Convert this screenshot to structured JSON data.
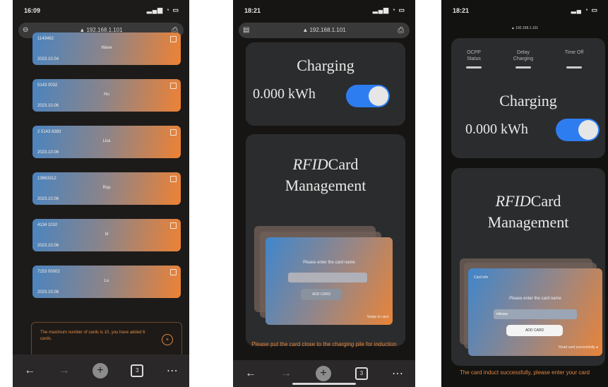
{
  "phone1": {
    "time": "16:09",
    "url": "192.168.1.101",
    "cards": [
      {
        "num": "1143462",
        "name": "Wave",
        "date": "2023.10.04"
      },
      {
        "num": "5143 0032",
        "name": "Hu",
        "date": "2023.10.06"
      },
      {
        "num": "2 5143 8383",
        "name": "Lisa",
        "date": "2023.10.06"
      },
      {
        "num": "13663312",
        "name": "Rop",
        "date": "2023.10.06"
      },
      {
        "num": "4134 1010",
        "name": "Id",
        "date": "2023.10.06"
      },
      {
        "num": "7153 00002",
        "name": "Lu",
        "date": "2023.10.06"
      }
    ],
    "notice": "The maximum number of cards is 10, you have added 6 cards.",
    "notice_icon": "plus-circle-icon"
  },
  "phone2": {
    "time": "18:21",
    "url": "192.168.1.101",
    "charging": "Charging",
    "kwh": "0.000 kWh",
    "rfid_italic": "RFID",
    "rfid_rest": "Card",
    "management": "Management",
    "prompt": "Please enter the card name",
    "add_card": "ADD CARD",
    "corner": "Swipe to card",
    "hint": "Please put the card close to the charging pile for induction"
  },
  "phone3": {
    "time": "18:21",
    "url": "192.168.1.101",
    "status_labels": [
      "OCPP Status",
      "Delay Charging",
      "Time Off"
    ],
    "charging": "Charging",
    "kwh": "0.000 kWh",
    "rfid_italic": "RFID",
    "rfid_rest": "Card",
    "management": "Management",
    "card_label": "Card info",
    "prompt": "Please enter the card name",
    "input_value": "mikasa",
    "add_card": "ADD CARD",
    "corner": "Read card successfully",
    "hint": "The card induct successfully, please enter your card"
  }
}
